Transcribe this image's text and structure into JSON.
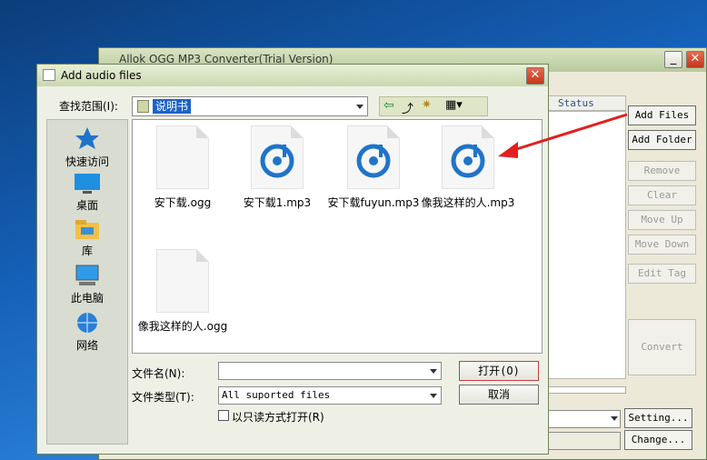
{
  "main_window": {
    "title": "Allok OGG MP3 Converter(Trial Version)",
    "status_column": "Status",
    "buttons": {
      "add_files": "Add Files",
      "add_folder": "Add Folder",
      "remove": "Remove",
      "clear": "Clear",
      "move_up": "Move Up",
      "move_down": "Move Down",
      "edit_tag": "Edit Tag",
      "convert": "Convert",
      "setting": "Setting...",
      "change": "Change..."
    }
  },
  "dialog": {
    "title": "Add audio files",
    "look_in_label": "查找范围(I):",
    "look_in_value": "说明书",
    "places": [
      "快速访问",
      "桌面",
      "库",
      "此电脑",
      "网络"
    ],
    "files": [
      {
        "name": "安下载.ogg",
        "type": "doc"
      },
      {
        "name": "安下载1.mp3",
        "type": "mp3"
      },
      {
        "name": "安下载fuyun.mp3",
        "type": "mp3"
      },
      {
        "name": "像我这样的人.mp3",
        "type": "mp3"
      },
      {
        "name": "像我这样的人.ogg",
        "type": "doc"
      }
    ],
    "filename_label": "文件名(N):",
    "filename_value": "",
    "filetype_label": "文件类型(T):",
    "filetype_value": "All suported files",
    "readonly_label": "以只读方式打开(R)",
    "open_button": "打开(O)",
    "cancel_button": "取消"
  },
  "colors": {
    "accent": "#1f74c9",
    "annotation_arrow": "#e02020"
  }
}
